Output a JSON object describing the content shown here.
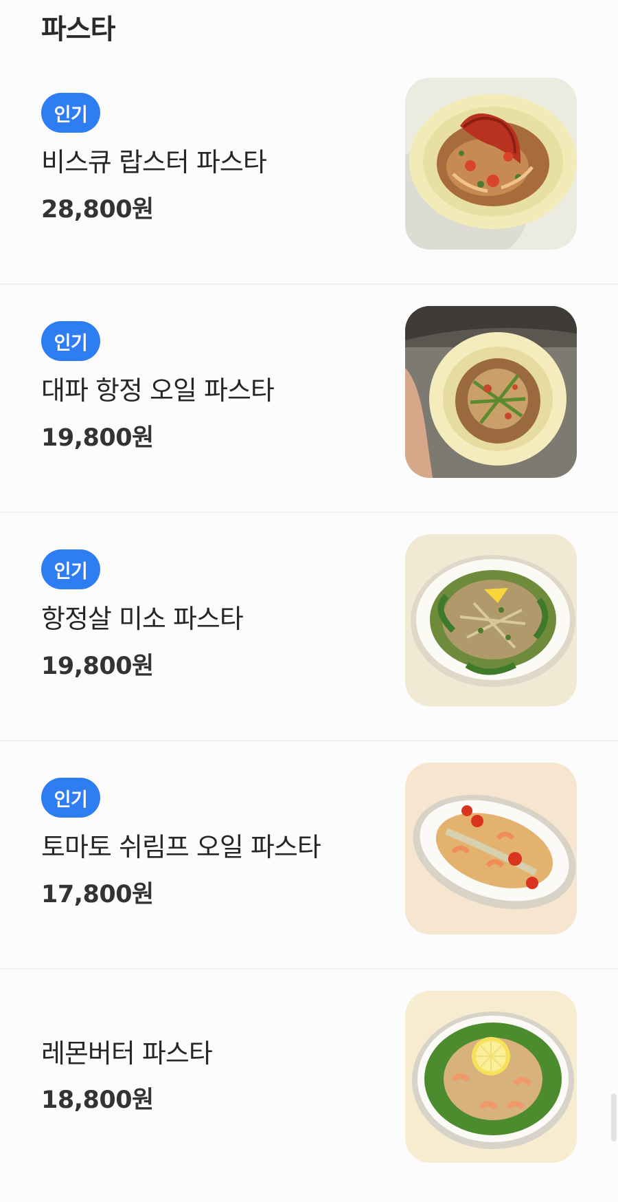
{
  "section": {
    "title": "파스타"
  },
  "menu": {
    "items": [
      {
        "badge": "인기",
        "name": "비스큐 랍스터 파스타",
        "price": "28,800원",
        "photo": "lobster-bisque-pasta-photo"
      },
      {
        "badge": "인기",
        "name": "대파 항정 오일 파스타",
        "price": "19,800원",
        "photo": "green-onion-pork-oil-pasta-photo"
      },
      {
        "badge": "인기",
        "name": "항정살 미소 파스타",
        "price": "19,800원",
        "photo": "pork-miso-pasta-photo"
      },
      {
        "badge": "인기",
        "name": "토마토 쉬림프 오일 파스타",
        "price": "17,800원",
        "photo": "tomato-shrimp-oil-pasta-photo"
      },
      {
        "badge": "",
        "name": "레몬버터 파스타",
        "price": "18,800원",
        "photo": "lemon-butter-pasta-photo"
      }
    ]
  },
  "colors": {
    "badge": "#2f7df2",
    "text": "#262626",
    "background": "#fcfcfc",
    "divider": "#efefef"
  }
}
